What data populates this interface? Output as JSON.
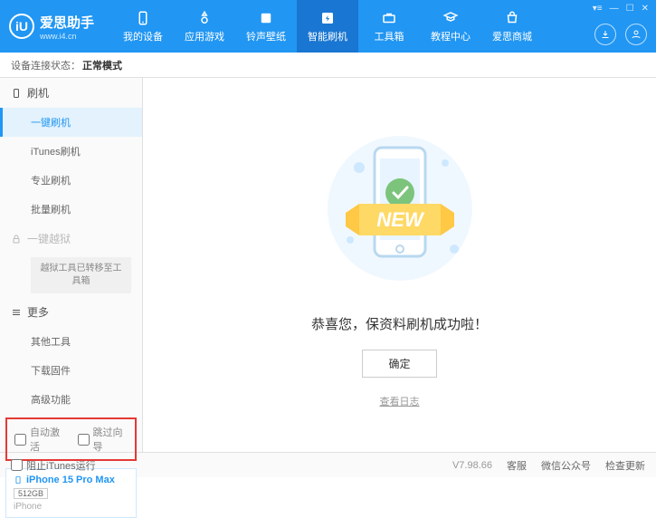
{
  "header": {
    "logo_text": "iU",
    "app_name": "爱思助手",
    "url": "www.i4.cn",
    "nav": [
      {
        "label": "我的设备",
        "icon": "device"
      },
      {
        "label": "应用游戏",
        "icon": "apps"
      },
      {
        "label": "铃声壁纸",
        "icon": "ringtone"
      },
      {
        "label": "智能刷机",
        "icon": "flash",
        "active": true
      },
      {
        "label": "工具箱",
        "icon": "toolbox"
      },
      {
        "label": "教程中心",
        "icon": "tutorial"
      },
      {
        "label": "爱思商城",
        "icon": "store"
      }
    ],
    "win_controls": [
      "menu",
      "minimize",
      "maximize",
      "close"
    ]
  },
  "status": {
    "label": "设备连接状态：",
    "value": "正常模式"
  },
  "sidebar": {
    "groups": [
      {
        "title": "刷机",
        "icon": "phone",
        "items": [
          "一键刷机",
          "iTunes刷机",
          "专业刷机",
          "批量刷机"
        ],
        "active_index": 0
      },
      {
        "title": "一键越狱",
        "icon": "lock",
        "locked": true,
        "note": "越狱工具已转移至工具箱"
      },
      {
        "title": "更多",
        "icon": "more",
        "items": [
          "其他工具",
          "下载固件",
          "高级功能"
        ]
      }
    ],
    "checkboxes": {
      "auto_activate": "自动激活",
      "skip_guide": "跳过向导"
    },
    "device": {
      "name": "iPhone 15 Pro Max",
      "storage": "512GB",
      "type": "iPhone"
    }
  },
  "main": {
    "ribbon_text": "NEW",
    "success_msg": "恭喜您，保资料刷机成功啦！",
    "ok_label": "确定",
    "log_link": "查看日志"
  },
  "footer": {
    "block_itunes": "阻止iTunes运行",
    "version": "V7.98.66",
    "links": [
      "客服",
      "微信公众号",
      "检查更新"
    ]
  }
}
